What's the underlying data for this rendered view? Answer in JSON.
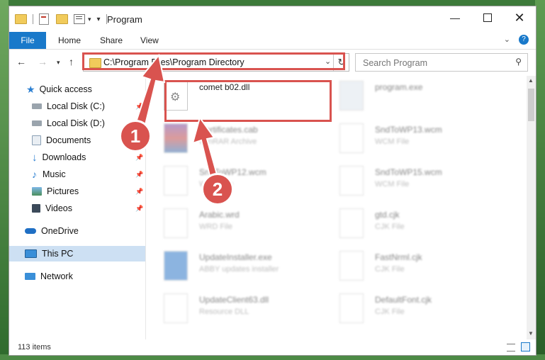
{
  "window": {
    "title": "Program"
  },
  "ribbon": {
    "tabs": [
      "File",
      "Home",
      "Share",
      "View"
    ]
  },
  "address": {
    "path": "C:\\Program Files\\Program Directory"
  },
  "search": {
    "placeholder": "Search Program"
  },
  "sidebar": {
    "items": [
      {
        "label": "Quick access",
        "icon": "star-icon"
      },
      {
        "label": "Local Disk (C:)",
        "icon": "drive-icon"
      },
      {
        "label": "Local Disk (D:)",
        "icon": "drive-icon"
      },
      {
        "label": "Documents",
        "icon": "documents-icon"
      },
      {
        "label": "Downloads",
        "icon": "download-arrow-icon"
      },
      {
        "label": "Music",
        "icon": "music-note-icon"
      },
      {
        "label": "Pictures",
        "icon": "pictures-icon"
      },
      {
        "label": "Videos",
        "icon": "film-icon"
      },
      {
        "label": "OneDrive",
        "icon": "cloud-icon"
      },
      {
        "label": "This PC",
        "icon": "monitor-icon"
      },
      {
        "label": "Network",
        "icon": "network-icon"
      }
    ]
  },
  "files": [
    {
      "name": "comet b02.dll",
      "type": ""
    },
    {
      "name": "program.exe",
      "type": ""
    },
    {
      "name": "Certificates.cab",
      "type": "WinRAR Archive"
    },
    {
      "name": "SndToWP13.wcm",
      "type": "WCM File"
    },
    {
      "name": "SndToWP12.wcm",
      "type": "WCM File"
    },
    {
      "name": "SndToWP15.wcm",
      "type": "WCM File"
    },
    {
      "name": "Arabic.wrd",
      "type": "WRD File"
    },
    {
      "name": "gtd.cjk",
      "type": "CJK File"
    },
    {
      "name": "UpdateInstaller.exe",
      "type": "ABBY updates installer"
    },
    {
      "name": "FastNrml.cjk",
      "type": "CJK File"
    },
    {
      "name": "UpdateClient63.dll",
      "type": "Resource DLL"
    },
    {
      "name": "DefaultFont.cjk",
      "type": "CJK File"
    }
  ],
  "status": {
    "count": "113 items"
  },
  "markers": {
    "one": "1",
    "two": "2"
  },
  "colors": {
    "accent": "#1979ca",
    "highlight": "#d9534f",
    "selection": "#cde0f3"
  }
}
